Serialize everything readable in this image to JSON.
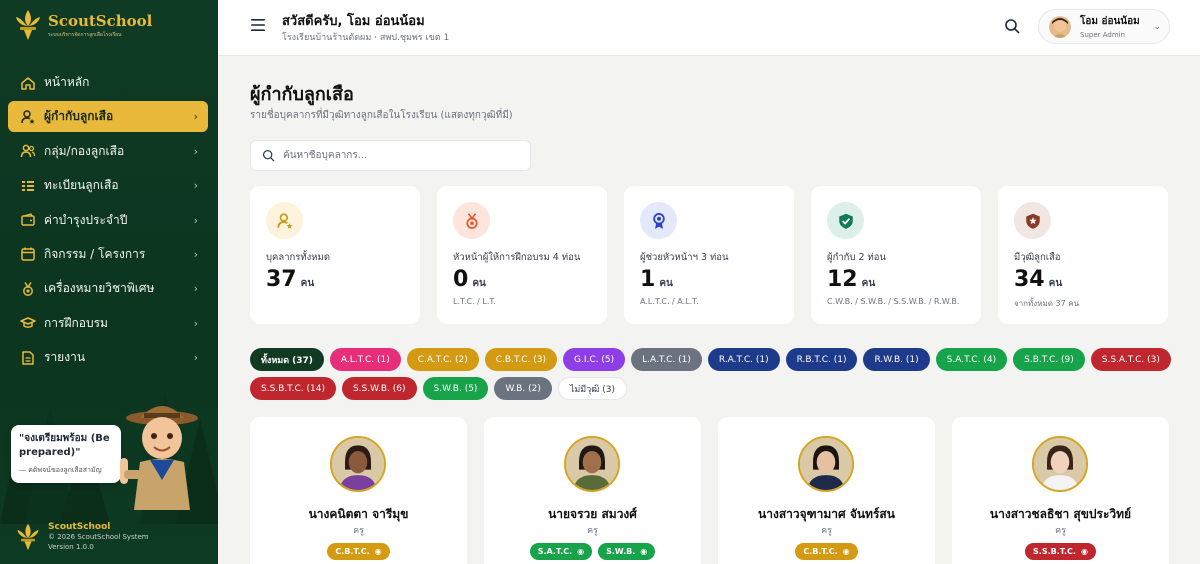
{
  "sidebar": {
    "brand_name": "ScoutSchool",
    "brand_sub": "ระบบบริหารจัดการลูกเสือโรงเรียน",
    "items": [
      {
        "label": "หน้าหลัก",
        "icon": "home-icon",
        "chevron": false
      },
      {
        "label": "ผู้กำกับลูกเสือ",
        "icon": "user-star-icon",
        "chevron": true
      },
      {
        "label": "กลุ่ม/กองลูกเสือ",
        "icon": "users-icon",
        "chevron": true
      },
      {
        "label": "ทะเบียนลูกเสือ",
        "icon": "list-icon",
        "chevron": true
      },
      {
        "label": "ค่าบำรุงประจำปี",
        "icon": "wallet-icon",
        "chevron": true
      },
      {
        "label": "กิจกรรม / โครงการ",
        "icon": "calendar-icon",
        "chevron": true
      },
      {
        "label": "เครื่องหมายวิชาพิเศษ",
        "icon": "medal-icon",
        "chevron": true
      },
      {
        "label": "การฝึกอบรม",
        "icon": "graduation-cap-icon",
        "chevron": true
      },
      {
        "label": "รายงาน",
        "icon": "report-icon",
        "chevron": true
      }
    ],
    "quote_text": "\"จงเตรียมพร้อม (Be prepared)\"",
    "quote_by": "— คติพจน์ของลูกเสือสามัญ",
    "footer_name": "ScoutSchool",
    "footer_copy": "© 2026 ScoutSchool System",
    "footer_version": "Version 1.0.0"
  },
  "header": {
    "greeting": "สวัสดีครับ, โอม อ่อนน้อม",
    "school": "โรงเรียนบ้านร้านตัดผม · สพป.ชุมพร เขต 1",
    "user_name": "โอม อ่อนน้อม",
    "user_role": "Super Admin"
  },
  "page": {
    "title": "ผู้กำกับลูกเสือ",
    "subtitle": "รายชื่อบุคลากรที่มีวุฒิทางลูกเสือในโรงเรียน (แสดงทุกวุฒิที่มี)",
    "search_placeholder": "ค้นหาชื่อบุคลากร..."
  },
  "stats": [
    {
      "label": "บุคลากรทั้งหมด",
      "value": "37",
      "unit": "คน",
      "note": "",
      "icon": "user-star-icon",
      "bg": "#fdf3dc",
      "fg": "#c89a1c"
    },
    {
      "label": "หัวหน้าผู้ให้การฝึกอบรม 4 ท่อน",
      "value": "0",
      "unit": "คน",
      "note": "L.T.C. / L.T.",
      "icon": "medal-icon",
      "bg": "#fde5dc",
      "fg": "#e4572e"
    },
    {
      "label": "ผู้ช่วยหัวหน้าฯ 3 ท่อน",
      "value": "1",
      "unit": "คน",
      "note": "A.L.T.C. / A.L.T.",
      "icon": "award-icon",
      "bg": "#e3e8fb",
      "fg": "#2c43c8"
    },
    {
      "label": "ผู้กำกับ 2 ท่อน",
      "value": "12",
      "unit": "คน",
      "note": "C.W.B. / S.W.B. / S.S.W.B. / R.W.B.",
      "icon": "shield-check-icon",
      "bg": "#dcefe8",
      "fg": "#117a5a"
    },
    {
      "label": "มีวุฒิลูกเสือ",
      "value": "34",
      "unit": "คน",
      "note": "จากทั้งหมด 37 คน",
      "icon": "shield-star-icon",
      "bg": "#f1e6e2",
      "fg": "#8b3a25"
    }
  ],
  "filters": [
    {
      "label": "ทั้งหมด (37)",
      "bg": "#113a22",
      "fg": "#ffffff",
      "bold": true
    },
    {
      "label": "A.L.T.C. (1)",
      "bg": "#e62e7b",
      "fg": "#ffffff"
    },
    {
      "label": "C.A.T.C. (2)",
      "bg": "#d49a12",
      "fg": "#ffffff"
    },
    {
      "label": "C.B.T.C. (3)",
      "bg": "#d49a12",
      "fg": "#ffffff"
    },
    {
      "label": "G.I.C. (5)",
      "bg": "#8e3ee6",
      "fg": "#ffffff"
    },
    {
      "label": "L.A.T.C. (1)",
      "bg": "#6b7280",
      "fg": "#ffffff"
    },
    {
      "label": "R.A.T.C. (1)",
      "bg": "#1e3a8a",
      "fg": "#ffffff"
    },
    {
      "label": "R.B.T.C. (1)",
      "bg": "#1e3a8a",
      "fg": "#ffffff"
    },
    {
      "label": "R.W.B. (1)",
      "bg": "#1e3a8a",
      "fg": "#ffffff"
    },
    {
      "label": "S.A.T.C. (4)",
      "bg": "#16a34a",
      "fg": "#ffffff"
    },
    {
      "label": "S.B.T.C. (9)",
      "bg": "#16a34a",
      "fg": "#ffffff"
    },
    {
      "label": "S.S.A.T.C. (3)",
      "bg": "#c0262d",
      "fg": "#ffffff"
    },
    {
      "label": "S.S.B.T.C. (14)",
      "bg": "#c0262d",
      "fg": "#ffffff"
    },
    {
      "label": "S.S.W.B. (6)",
      "bg": "#c0262d",
      "fg": "#ffffff"
    },
    {
      "label": "S.W.B. (5)",
      "bg": "#16a34a",
      "fg": "#ffffff"
    },
    {
      "label": "W.B. (2)",
      "bg": "#6b7280",
      "fg": "#ffffff"
    },
    {
      "label": "ไม่มีวุฒิ (3)",
      "bg": "#ffffff",
      "fg": "#374151"
    }
  ],
  "people": [
    {
      "name": "นางคนิตตา จารีมุข",
      "role": "ครู",
      "skin": "#8a5a3c",
      "hair": "#2a1b14",
      "shirt": "#7b3fa0",
      "badges": [
        {
          "label": "C.B.T.C.",
          "bg": "#d49a12"
        }
      ]
    },
    {
      "name": "นายจรวย สมวงศ์",
      "role": "ครู",
      "skin": "#a0704c",
      "hair": "#1f1a18",
      "shirt": "#5a6b3a",
      "badges": [
        {
          "label": "S.A.T.C.",
          "bg": "#16a34a"
        },
        {
          "label": "S.W.B.",
          "bg": "#16a34a"
        }
      ]
    },
    {
      "name": "นางสาวจุฑามาศ จันทร์สน",
      "role": "ครู",
      "skin": "#e6c0a0",
      "hair": "#1a1412",
      "shirt": "#1f2a4a",
      "badges": [
        {
          "label": "C.B.T.C.",
          "bg": "#d49a12"
        }
      ]
    },
    {
      "name": "นางสาวชลธิชา สุขประวิทย์",
      "role": "ครู",
      "skin": "#f1d2bc",
      "hair": "#3a2418",
      "shirt": "#f3f3f3",
      "badges": [
        {
          "label": "S.S.B.T.C.",
          "bg": "#c0262d"
        }
      ]
    }
  ]
}
